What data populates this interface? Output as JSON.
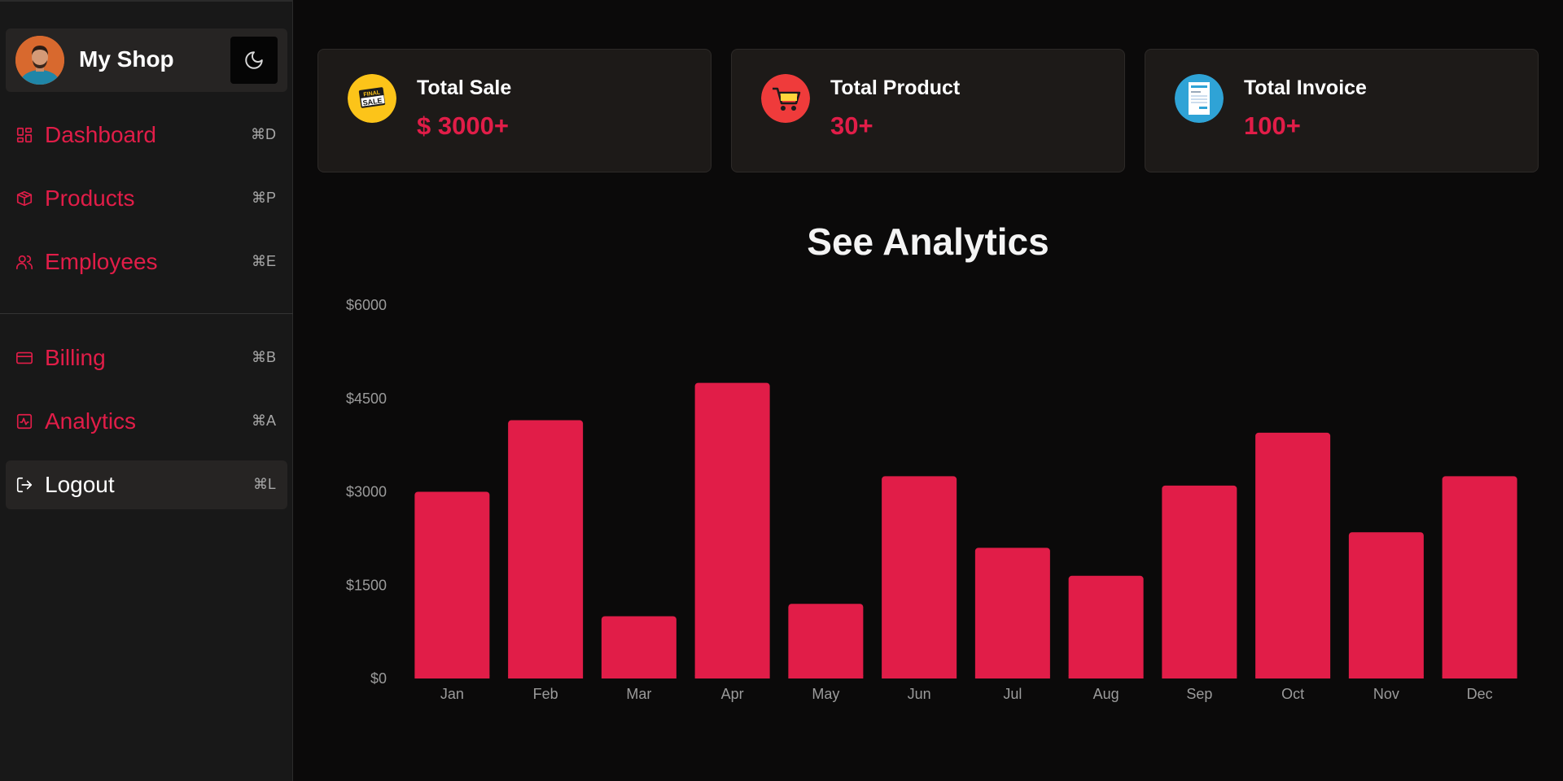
{
  "sidebar": {
    "shop_name": "My Shop",
    "theme_toggle_icon": "moon-icon",
    "items": [
      {
        "label": "Dashboard",
        "shortcut": "⌘D",
        "icon": "dashboard-icon"
      },
      {
        "label": "Products",
        "shortcut": "⌘P",
        "icon": "package-icon"
      },
      {
        "label": "Employees",
        "shortcut": "⌘E",
        "icon": "users-icon"
      },
      {
        "label": "Billing",
        "shortcut": "⌘B",
        "icon": "credit-card-icon"
      },
      {
        "label": "Analytics",
        "shortcut": "⌘A",
        "icon": "activity-icon"
      },
      {
        "label": "Logout",
        "shortcut": "⌘L",
        "icon": "logout-icon"
      }
    ]
  },
  "cards": [
    {
      "title": "Total Sale",
      "value": "$ 3000+",
      "icon": "final-sale-icon"
    },
    {
      "title": "Total Product",
      "value": "30+",
      "icon": "shopping-cart-icon"
    },
    {
      "title": "Total Invoice",
      "value": "100+",
      "icon": "invoice-icon"
    }
  ],
  "analytics": {
    "title": "See Analytics"
  },
  "colors": {
    "accent": "#e11d48",
    "background": "#0b0a0a",
    "sidebar": "#181818",
    "card": "#1d1a18"
  },
  "chart_data": {
    "type": "bar",
    "categories": [
      "Jan",
      "Feb",
      "Mar",
      "Apr",
      "May",
      "Jun",
      "Jul",
      "Aug",
      "Sep",
      "Oct",
      "Nov",
      "Dec"
    ],
    "values": [
      3000,
      4150,
      1000,
      4750,
      1200,
      3250,
      2100,
      1650,
      3100,
      3950,
      2350,
      3250
    ],
    "ylim": [
      0,
      6000
    ],
    "yticks": [
      "$0",
      "$1500",
      "$3000",
      "$4500",
      "$6000"
    ],
    "ytick_values": [
      0,
      1500,
      3000,
      4500,
      6000
    ],
    "grid": false,
    "legend": "none"
  }
}
